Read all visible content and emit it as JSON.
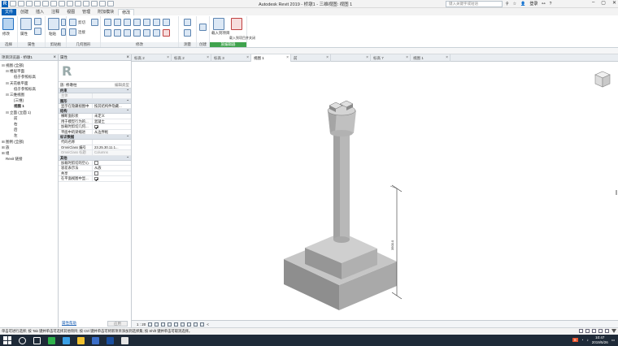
{
  "app": {
    "title": "Autodesk Revit 2019 - 桥墩1 - 三维视图: 视图 1",
    "logo_letter": "R"
  },
  "search": {
    "placeholder": "键入关键字或短语"
  },
  "account": {
    "login_label": "登录"
  },
  "ribbon": {
    "tabs": [
      "文件",
      "创建",
      "插入",
      "注释",
      "视图",
      "管理",
      "附加模块",
      "修改"
    ],
    "groups": {
      "select": "选择",
      "properties": "属性",
      "clipboard": "剪贴板",
      "geometry": "几何图形",
      "modify": "修改",
      "measure": "测量",
      "create": "创建",
      "family_editor": "族编辑器"
    },
    "labels": {
      "modify": "修改",
      "properties": "属性",
      "paste": "粘贴",
      "cut": "剪切",
      "join": "连接",
      "load_into_project": "载入到项目",
      "load_into_project_close": "载入到项目并关闭"
    }
  },
  "project_browser": {
    "title": "项目浏览器 - 桥墩1",
    "tree": [
      {
        "label": "视图 (全部)",
        "level": 0,
        "toggle": "⊟"
      },
      {
        "label": "楼层平面",
        "level": 1,
        "toggle": "⊟"
      },
      {
        "label": "低于参照标高",
        "level": 2,
        "toggle": ""
      },
      {
        "label": "天花板平面",
        "level": 1,
        "toggle": "⊟"
      },
      {
        "label": "低于参照标高",
        "level": 2,
        "toggle": ""
      },
      {
        "label": "三维视图",
        "level": 1,
        "toggle": "⊟"
      },
      {
        "label": "{三维}",
        "level": 2,
        "toggle": ""
      },
      {
        "label": "视图 1",
        "level": 2,
        "toggle": "",
        "bold": true
      },
      {
        "label": "立面 (立面 1)",
        "level": 1,
        "toggle": "⊟"
      },
      {
        "label": "前",
        "level": 2,
        "toggle": ""
      },
      {
        "label": "右",
        "level": 2,
        "toggle": ""
      },
      {
        "label": "后",
        "level": 2,
        "toggle": ""
      },
      {
        "label": "左",
        "level": 2,
        "toggle": ""
      },
      {
        "label": "图例 (全部)",
        "level": 0,
        "toggle": "⊞"
      },
      {
        "label": "族",
        "level": 0,
        "toggle": "⊞"
      },
      {
        "label": "组",
        "level": 0,
        "toggle": "⊞"
      },
      {
        "label": "Revit 链接",
        "level": 0,
        "toggle": ""
      }
    ]
  },
  "properties": {
    "title": "属性",
    "type_selector": "族: 桥墩柱",
    "edit_type": "编辑类型",
    "sections": [
      {
        "name": "约束",
        "rows": [
          {
            "k": "主体",
            "v": "",
            "grey": true
          }
        ]
      },
      {
        "name": "图形",
        "rows": [
          {
            "k": "显示在隐藏视图中",
            "v": "按其结构件隐藏..."
          }
        ]
      },
      {
        "name": "结构",
        "rows": [
          {
            "k": "横断面形状",
            "v": "未定义"
          },
          {
            "k": "用于模型行为的...",
            "v": "混凝土"
          },
          {
            "k": "加载时剪切几何...",
            "v": "",
            "check": true
          },
          {
            "k": "平面中的梁缩进",
            "v": "从边界框"
          }
        ]
      },
      {
        "name": "标识数据",
        "rows": [
          {
            "k": "代码名称",
            "v": ""
          },
          {
            "k": "OmniClass 编号",
            "v": "23.25.30.11.1..."
          },
          {
            "k": "OmniClass 标题",
            "v": "Columns",
            "grey": true
          }
        ]
      },
      {
        "name": "其他",
        "rows": [
          {
            "k": "加载时剪切的空心",
            "v": "",
            "check": false
          },
          {
            "k": "容差表示法",
            "v": "从族"
          },
          {
            "k": "共享",
            "v": "",
            "check": false
          },
          {
            "k": "在平面视图中显...",
            "v": "",
            "check": true
          }
        ]
      }
    ],
    "help_link": "属性帮助",
    "apply": "应用"
  },
  "view_tabs": [
    {
      "label": "标高 2",
      "active": false
    },
    {
      "label": "标高 2",
      "active": false
    },
    {
      "label": "标高 3",
      "active": false
    },
    {
      "label": "视图 1",
      "active": true
    },
    {
      "label": "前",
      "active": false
    },
    {
      "label": "",
      "active": false
    },
    {
      "label": "标高 7",
      "active": false
    },
    {
      "label": "视图 1",
      "active": false
    }
  ],
  "viewport": {
    "dimension_text": "3500.0",
    "scale": "1 : 20"
  },
  "status": {
    "hint": "单击可进行选择; 按 Tab 键并单击可选择其他项目; 按 Ctrl 键并单击可将新项目添加到选择集; 按 Shift 键并单击可取消选择。"
  },
  "taskbar": {
    "time": "10:47",
    "date": "2019/5/26"
  },
  "colors": {
    "accent": "#0a61b8",
    "ribbon_context": "#3fa34d"
  }
}
